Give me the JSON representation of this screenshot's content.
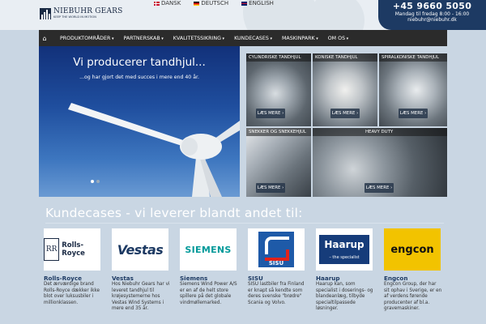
{
  "header": {
    "logo_name": "NIEBUHR GEARS",
    "logo_tag": "KEEP THE WORLD IN MOTION",
    "languages": [
      {
        "label": "DANSK",
        "colors": [
          "#c8102e",
          "#ffffff"
        ]
      },
      {
        "label": "DEUTSCH",
        "colors": [
          "#000000",
          "#dd0000",
          "#ffce00"
        ]
      },
      {
        "label": "ENGLISH",
        "colors": [
          "#012169",
          "#c8102e"
        ]
      }
    ],
    "phone": "+45 9660 5050",
    "hours": "Mandag til fredag 8:00 - 16:00",
    "email": "niebuhr@niebuhr.dk"
  },
  "nav": {
    "items": [
      "PRODUKTOMRÅDER",
      "PARTNERSKAB",
      "KVALITETSSIKRING",
      "KUNDECASES",
      "MASKINPARK",
      "OM OS"
    ]
  },
  "hero": {
    "title": "Vi producerer tandhjul...",
    "subtitle": "...og har gjort det med succes i mere end 40 år.",
    "slide_count": 2,
    "active_slide": 1
  },
  "tiles": [
    {
      "label": "CYLINDRISKE TANDHJUL",
      "button": "LÆS MERE ›"
    },
    {
      "label": "KONISKE TANDHJUL",
      "button": "LÆS MERE ›"
    },
    {
      "label": "SPIRALKONISKE TANDHJUL",
      "button": "LÆS MERE ›"
    },
    {
      "label": "SNEKKER OG SNEKKEHJUL",
      "button": "LÆS MERE ›"
    },
    {
      "label": "HEAVY DUTY",
      "button": "LÆS MERE ›"
    }
  ],
  "cases": {
    "title": "Kundecases - vi leverer blandt andet til:",
    "cards": [
      {
        "logo_text": "Rolls-Royce",
        "name": "Rolls-Royce",
        "desc": "Det ærværdige brand Rolls-Royce dækker ikke blot over luksusbiler i millionklassen."
      },
      {
        "logo_text": "Vestas",
        "name": "Vestas",
        "desc": "Hos Niebuhr Gears har vi leveret tandhjul til krøjesystemerne hos Vestas Wind Systems i mere end 35 år."
      },
      {
        "logo_text": "SIEMENS",
        "name": "Siemens",
        "desc": "Siemens Wind Power A/S er en af de helt store spillere på det globale vindmøllemarked."
      },
      {
        "logo_text": "SISU",
        "name": "SISU",
        "desc": "SISU lastbiler fra Finland er knapt så kendte som deres svenske \"brødre\" Scania og Volvo."
      },
      {
        "logo_text": "Haarup",
        "logo_sub": "– the specialist",
        "name": "Haarup",
        "desc": "Haarup kan, som specialist i doserings- og blandeanlæg, tilbyde specialtilpassede løsninger."
      },
      {
        "logo_text": "engcon",
        "name": "Engcon",
        "desc": "Engcon Group, der har sit ophav i Sverige, er en af verdens førende producenter af bl.a. gravemaskiner."
      }
    ]
  },
  "colors": {
    "navy": "#1d3a63",
    "nav_bg": "#2b2b2b",
    "page_bg": "#c9d6e3"
  }
}
